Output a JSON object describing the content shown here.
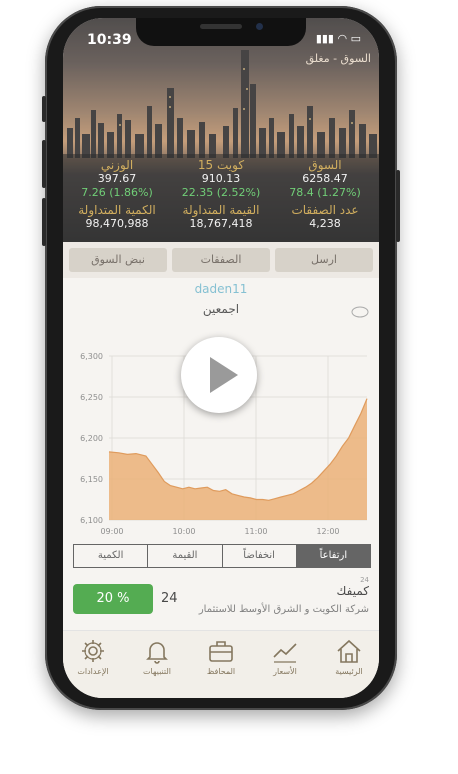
{
  "status": {
    "time": "10:39"
  },
  "market_state": "السوق - مغلق",
  "stats": {
    "market": {
      "label": "السوق",
      "value": "6258.47",
      "change": "78.4 (1.27%)"
    },
    "kuwait15": {
      "label": "كويت 15",
      "value": "910.13",
      "change": "22.35 (2.52%)"
    },
    "weighted": {
      "label": "الوزني",
      "value": "397.67",
      "change": "7.26 (1.86%)"
    },
    "deals": {
      "label": "عدد الصفقات",
      "value": "4,238"
    },
    "traded_value": {
      "label": "القيمة المتداولة",
      "value": "18,767,418"
    },
    "traded_qty": {
      "label": "الكمية المتداولة",
      "value": "98,470,988"
    }
  },
  "top_tabs": {
    "send": "ارسل",
    "deals": "الصفقات",
    "pulse": "نبض السوق"
  },
  "username": "daden11",
  "chart_title": "اجمعين",
  "chart_data": {
    "type": "area",
    "x_ticks": [
      "09:00",
      "10:00",
      "11:00",
      "12:00"
    ],
    "y_ticks": [
      "6,100",
      "6,150",
      "6,200",
      "6,250",
      "6,300"
    ],
    "ylim": [
      6100,
      6300
    ],
    "xlim": [
      0,
      210
    ],
    "color": "#e6a05a",
    "x": [
      0,
      8,
      15,
      22,
      30,
      35,
      40,
      45,
      50,
      55,
      60,
      65,
      70,
      75,
      80,
      85,
      90,
      95,
      100,
      105,
      110,
      115,
      120,
      125,
      130,
      135,
      140,
      145,
      150,
      155,
      160,
      165,
      170,
      175,
      180,
      185,
      190,
      195,
      200,
      205,
      210
    ],
    "y": [
      6183,
      6182,
      6180,
      6181,
      6178,
      6168,
      6158,
      6147,
      6142,
      6140,
      6138,
      6140,
      6138,
      6139,
      6140,
      6136,
      6135,
      6137,
      6132,
      6130,
      6128,
      6127,
      6125,
      6125,
      6124,
      6126,
      6128,
      6130,
      6132,
      6136,
      6140,
      6145,
      6152,
      6160,
      6168,
      6178,
      6190,
      6200,
      6215,
      6230,
      6248
    ]
  },
  "segments": {
    "up": "ارتفاعاً",
    "down": "انخفاضاً",
    "value": "القيمة",
    "qty": "الكمية"
  },
  "row": {
    "percent": "20 %",
    "count": "24",
    "rank": "24",
    "name": "كميفك",
    "subtitle": "شركة الكويت و الشرق الأوسط للاستثمار"
  },
  "nav": {
    "home": "الرئيسية",
    "prices": "الأسعار",
    "portfolio": "المحافظ",
    "alerts": "التنبيهات",
    "settings": "الإعدادات"
  }
}
